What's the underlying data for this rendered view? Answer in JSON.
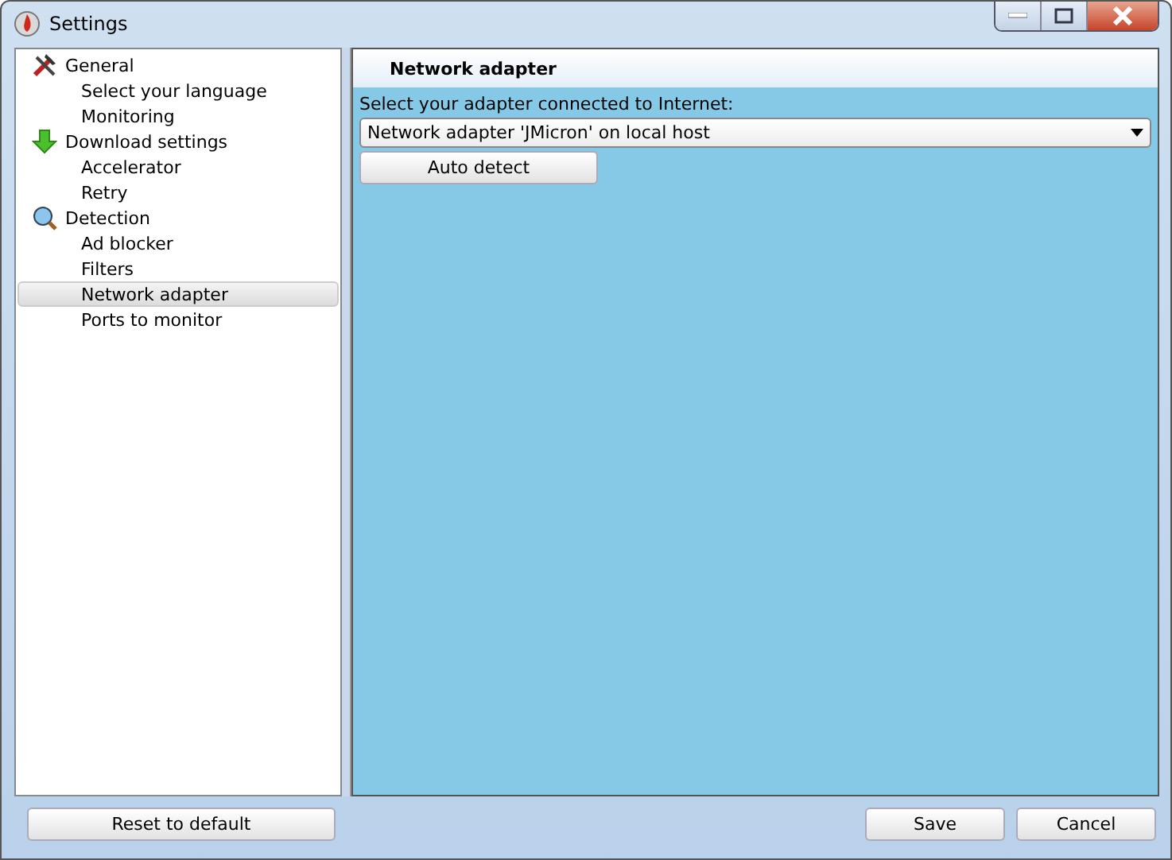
{
  "window": {
    "title": "Settings"
  },
  "sidebar": {
    "groups": [
      {
        "label": "General",
        "children": [
          {
            "label": "Select your language",
            "selected": false
          },
          {
            "label": "Monitoring",
            "selected": false
          }
        ]
      },
      {
        "label": "Download settings",
        "children": [
          {
            "label": "Accelerator",
            "selected": false
          },
          {
            "label": "Retry",
            "selected": false
          }
        ]
      },
      {
        "label": "Detection",
        "children": [
          {
            "label": "Ad blocker",
            "selected": false
          },
          {
            "label": "Filters",
            "selected": false
          },
          {
            "label": "Network adapter",
            "selected": true
          },
          {
            "label": "Ports to monitor",
            "selected": false
          }
        ]
      }
    ]
  },
  "panel": {
    "title": "Network adapter",
    "field_label": "Select your adapter connected to Internet:",
    "dropdown_value": "Network adapter 'JMicron' on local host",
    "button": "Auto detect"
  },
  "buttons": {
    "reset": "Reset to default",
    "save": "Save",
    "cancel": "Cancel"
  }
}
